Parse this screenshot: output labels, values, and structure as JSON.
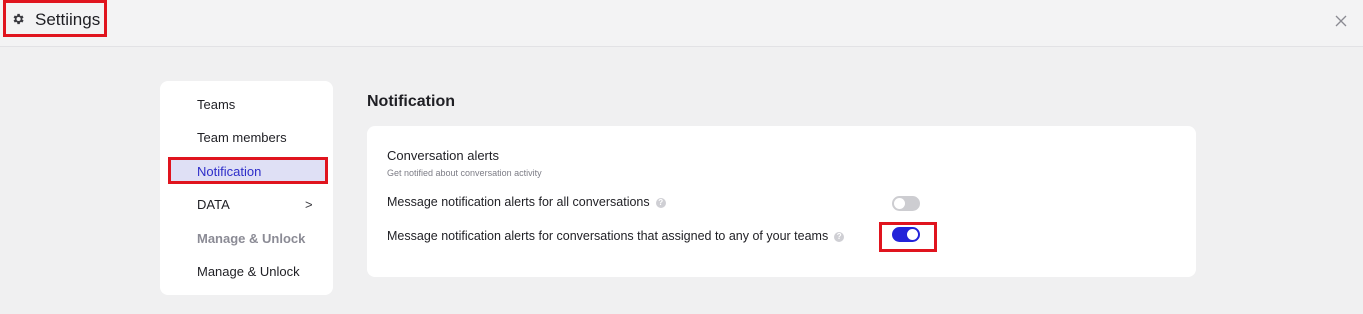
{
  "header": {
    "title": "Settiings",
    "title_icon": "gear-icon",
    "close_icon": "close-icon",
    "close_glyph": "×"
  },
  "sidebar": {
    "items": [
      {
        "label": "Teams"
      },
      {
        "label": "Team members"
      },
      {
        "label": "Notification",
        "active": true
      },
      {
        "label": "DATA",
        "chevron": ">"
      },
      {
        "label": "Manage & Unlock",
        "disabled": true
      },
      {
        "label": "Manage & Unlock"
      }
    ]
  },
  "main": {
    "title": "Notification",
    "card": {
      "heading": "Conversation alerts",
      "subheading": "Get notified about conversation activity",
      "rows": [
        {
          "label": "Message notification alerts for all conversations",
          "info_icon": "info-icon",
          "enabled": false
        },
        {
          "label": "Message notification alerts for conversations that assigned to any of your teams",
          "info_icon": "info-icon",
          "enabled": true
        }
      ]
    }
  },
  "colors": {
    "accent": "#2323d9",
    "active_bg": "#dfe0f5",
    "highlight_border": "#e0141e"
  }
}
